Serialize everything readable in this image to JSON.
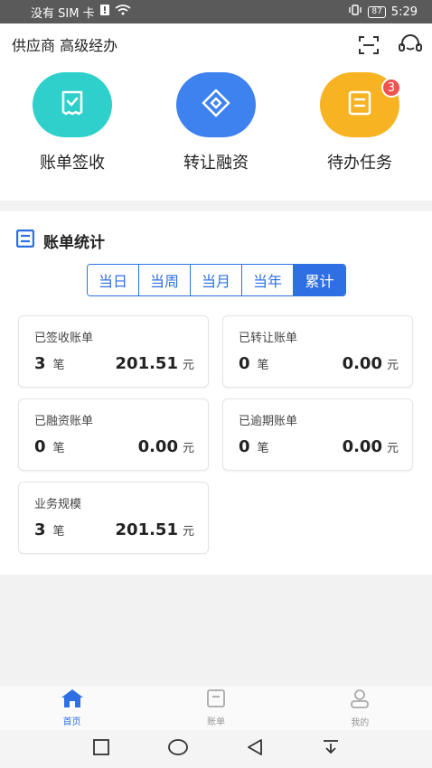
{
  "status_bar": {
    "carrier": "没有 SIM 卡",
    "battery": "87",
    "time": "5:29"
  },
  "header": {
    "role": "供应商 高级经办",
    "icons": [
      "scan-icon",
      "headset-service-icon"
    ]
  },
  "quick_actions": [
    {
      "label": "账单签收",
      "color": "#2fd0cb",
      "icon": "receipt-icon"
    },
    {
      "label": "转让融资",
      "color": "#3e82f0",
      "icon": "diamond-icon"
    },
    {
      "label": "待办任务",
      "color": "#f7b321",
      "icon": "task-icon",
      "badge": "3"
    }
  ],
  "stats": {
    "title": "账单统计",
    "tabs": [
      "当日",
      "当周",
      "当月",
      "当年",
      "累计"
    ],
    "active_tab": "累计",
    "cards": [
      {
        "label": "已签收账单",
        "count": "3",
        "count_unit": "笔",
        "amount": "201.51",
        "amount_unit": "元"
      },
      {
        "label": "已转让账单",
        "count": "0",
        "count_unit": "笔",
        "amount": "0.00",
        "amount_unit": "元"
      },
      {
        "label": "已融资账单",
        "count": "0",
        "count_unit": "笔",
        "amount": "0.00",
        "amount_unit": "元"
      },
      {
        "label": "已逾期账单",
        "count": "0",
        "count_unit": "笔",
        "amount": "0.00",
        "amount_unit": "元"
      },
      {
        "label": "业务规模",
        "count": "3",
        "count_unit": "笔",
        "amount": "201.51",
        "amount_unit": "元"
      }
    ]
  },
  "tabbar": [
    {
      "label": "首页",
      "icon": "home-icon",
      "active": true
    },
    {
      "label": "账单",
      "icon": "bill-icon",
      "active": false
    },
    {
      "label": "我的",
      "icon": "user-icon",
      "active": false
    }
  ],
  "colors": {
    "accent": "#2f6fe4",
    "badge": "#f0524f"
  }
}
